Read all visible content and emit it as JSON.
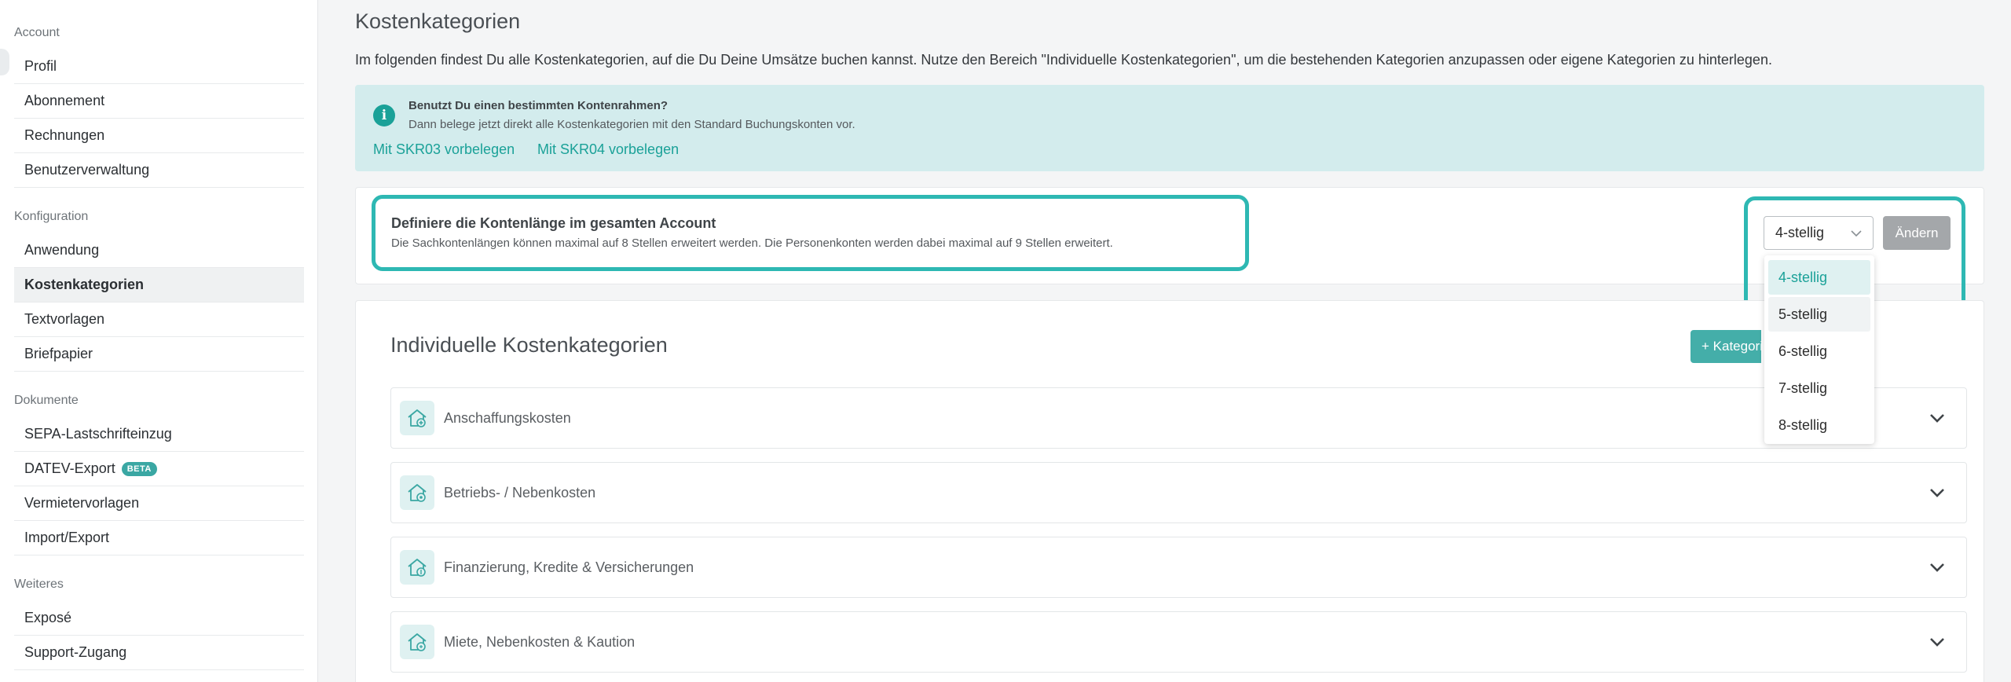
{
  "sidebar": {
    "sections": [
      {
        "title": "Account",
        "items": [
          "Profil",
          "Abonnement",
          "Rechnungen",
          "Benutzerverwaltung"
        ]
      },
      {
        "title": "Konfiguration",
        "items": [
          "Anwendung",
          "Kostenkategorien",
          "Textvorlagen",
          "Briefpapier"
        ]
      },
      {
        "title": "Dokumente",
        "items": [
          "SEPA-Lastschrifteinzug",
          "DATEV-Export",
          "Vermietervorlagen",
          "Import/Export"
        ]
      },
      {
        "title": "Weiteres",
        "items": [
          "Exposé",
          "Support-Zugang"
        ]
      }
    ],
    "active_item": "Kostenkategorien",
    "beta_badge": "BETA"
  },
  "main": {
    "title": "Kostenkategorien",
    "description": "Im folgenden findest Du alle Kostenkategorien, auf die Du Deine Umsätze buchen kannst. Nutze den Bereich \"Individuelle Kostenkategorien\", um die bestehenden Kategorien anzupassen oder eigene Kategorien zu hinterlegen.",
    "info": {
      "title": "Benutzt Du einen bestimmten Kontenrahmen?",
      "text": "Dann belege jetzt direkt alle Kostenkategorien mit den Standard Buchungskonten vor.",
      "link_skr03": "Mit SKR03 vorbelegen",
      "link_skr04": "Mit SKR04 vorbelegen"
    },
    "kontenlaenge": {
      "title": "Definiere die Kontenlänge im gesamten Account",
      "text": "Die Sachkontenlängen können maximal auf 8 Stellen erweitert werden. Die Personenkonten werden dabei maximal auf 9 Stellen erweitert.",
      "select_value": "4-stellig",
      "options": [
        "4-stellig",
        "5-stellig",
        "6-stellig",
        "7-stellig",
        "8-stellig"
      ],
      "change_button": "Ändern"
    },
    "individuelle": {
      "title": "Individuelle Kostenkategorien",
      "add_button": "+ Kategorie",
      "categories": [
        "Anschaffungskosten",
        "Betriebs- / Nebenkosten",
        "Finanzierung, Kredite & Versicherungen",
        "Miete, Nebenkosten & Kaution"
      ]
    }
  },
  "colors": {
    "accent": "#1aa198",
    "highlight": "#2eb8b3",
    "info_bg": "#d3eced"
  }
}
